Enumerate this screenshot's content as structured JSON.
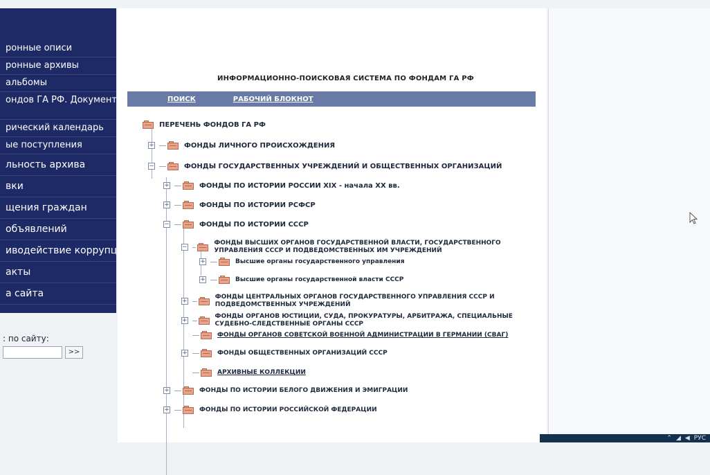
{
  "sidebar": {
    "items": [
      {
        "label": "ронные описи"
      },
      {
        "label": "ронные архивы"
      },
      {
        "label": "альбомы"
      },
      {
        "label": "ондов ГА РФ. Документы етельствуют..."
      },
      {
        "label": "рический календарь"
      },
      {
        "label": "ые поступления"
      },
      {
        "label": "льность архива"
      },
      {
        "label": "вки"
      },
      {
        "label": "щения граждан"
      },
      {
        "label": "объявлений"
      },
      {
        "label": "иводействие коррупции"
      },
      {
        "label": "акты"
      },
      {
        "label": "а сайта"
      }
    ],
    "search": {
      "label": ": по сайту:",
      "button": ">>"
    }
  },
  "main": {
    "system_title": "ИНФОРМАЦИОННО-ПОИСКОВАЯ СИСТЕМА ПО ФОНДАМ ГА РФ",
    "nav": {
      "search": "ПОИСК",
      "notebook": "РАБОЧИЙ БЛОКНОТ"
    },
    "tree": {
      "root": "ПЕРЕЧЕНЬ ФОНДОВ ГА РФ",
      "personal": "ФОНДЫ ЛИЧНОГО ПРОИСХОЖДЕНИЯ",
      "state": "ФОНДЫ ГОСУДАРСТВЕННЫХ УЧРЕЖДЕНИЙ И ОБЩЕСТВЕННЫХ ОРГАНИЗАЦИЙ",
      "russia_19_20": "ФОНДЫ ПО ИСТОРИИ РОССИИ XIX - начала XX вв.",
      "rsfsr": "ФОНДЫ ПО ИСТОРИИ РСФСР",
      "ussr": "ФОНДЫ ПО ИСТОРИИ СССР",
      "higher_bodies": "ФОНДЫ ВЫСШИХ ОРГАНОВ ГОСУДАРСТВЕННОЙ ВЛАСТИ, ГОСУДАРСТВЕННОГО УПРАВЛЕНИЯ СССР И ПОДВЕДОМСТВЕННЫХ ИМ УЧРЕЖДЕНИЙ",
      "higher_management": "Высшие органы государственного управления",
      "higher_power": "Высшие органы государственной власти СССР",
      "central_bodies": "ФОНДЫ ЦЕНТРАЛЬНЫХ ОРГАНОВ ГОСУДАРСТВЕННОГО УПРАВЛЕНИЯ СССР И ПОДВЕДОМСТВЕННЫХ УЧРЕЖДЕНИЙ",
      "justice": "ФОНДЫ ОРГАНОВ ЮСТИЦИИ, СУДА, ПРОКУРАТУРЫ, АРБИТРАЖА, СПЕЦИАЛЬНЫЕ СУДЕБНО-СЛЕДСТВЕННЫЕ ОРГАНЫ СССР",
      "svag": "ФОНДЫ ОРГАНОВ СОВЕТСКОЙ ВОЕННОЙ АДМИНИСТРАЦИИ В ГЕРМАНИИ (СВАГ)",
      "public_orgs": "ФОНДЫ ОБЩЕСТВЕННЫХ ОРГАНИЗАЦИЙ СССР",
      "archival": "АРХИВНЫЕ КОЛЛЕКЦИИ",
      "white_movement": "ФОНДЫ ПО ИСТОРИИ БЕЛОГО ДВИЖЕНИЯ И ЭМИГРАЦИИ",
      "rf": "ФОНДЫ ПО ИСТОРИИ РОССИЙСКОЙ ФЕДЕРАЦИИ"
    }
  },
  "taskbar": {
    "lang": "РУС"
  },
  "colors": {
    "sidebar": "#1e2a66",
    "navbar": "#6a7aa6",
    "folder": "#e7a38b"
  }
}
